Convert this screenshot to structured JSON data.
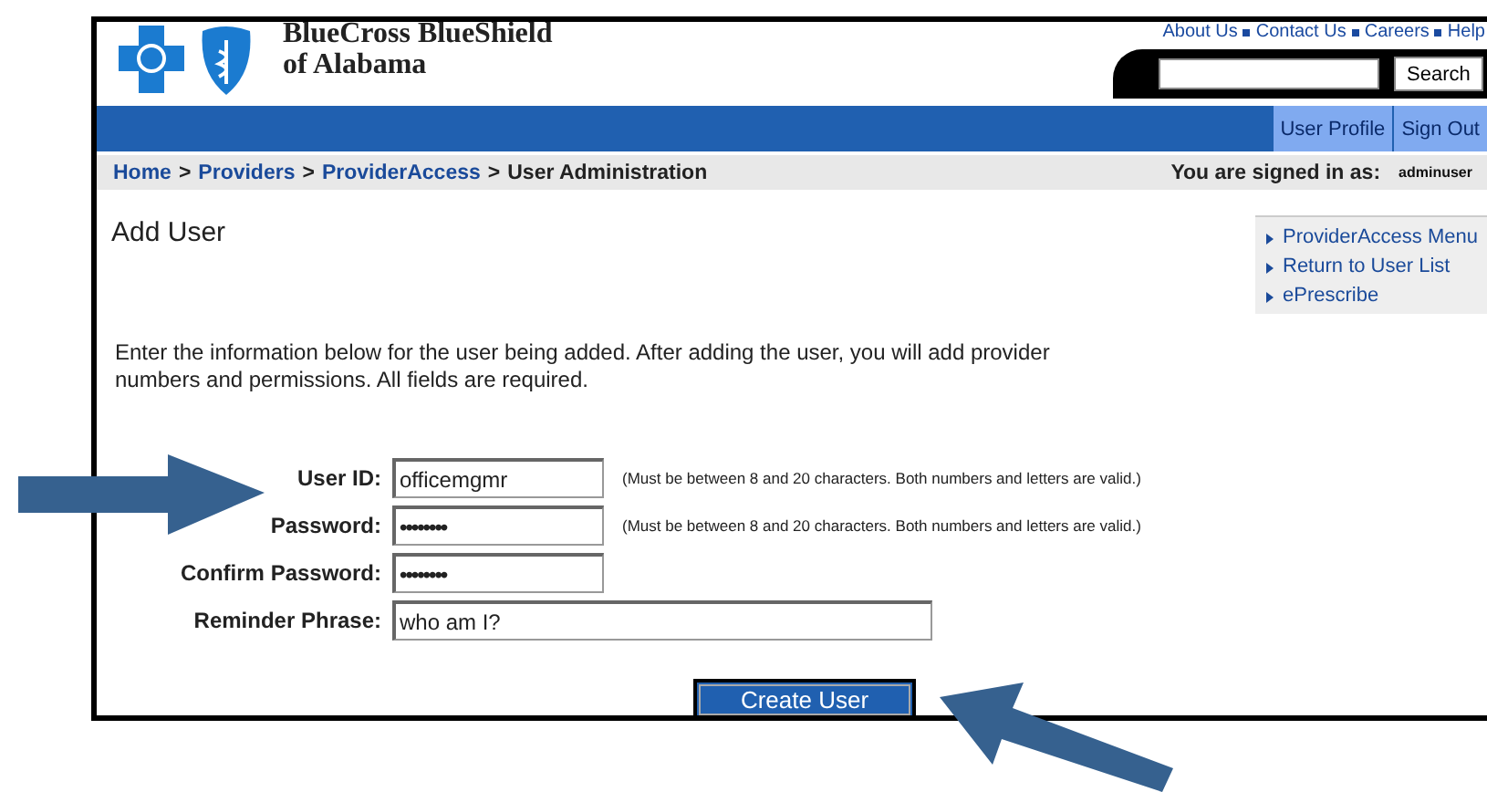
{
  "header": {
    "logo_lines": [
      "BlueCross BlueShield",
      "of Alabama"
    ],
    "top_links": [
      "About Us",
      "Contact Us",
      "Careers",
      "Help"
    ],
    "search": {
      "button": "Search"
    }
  },
  "nav": {
    "tabs": [
      "User Profile",
      "Sign Out"
    ]
  },
  "breadcrumb": {
    "items": [
      {
        "kind": "link",
        "text": "Home"
      },
      {
        "kind": "separator",
        "text": ">"
      },
      {
        "kind": "link",
        "text": "Providers"
      },
      {
        "kind": "separator",
        "text": ">"
      },
      {
        "kind": "link",
        "text": "ProviderAccess"
      },
      {
        "kind": "separator",
        "text": ">"
      },
      {
        "kind": "current",
        "text": "User Administration"
      }
    ],
    "signed_in_label": "You are signed in as:",
    "username": "adminuser"
  },
  "page_title": "Add User",
  "side_menu": [
    "ProviderAccess Menu",
    "Return to User List",
    "ePrescribe"
  ],
  "intro": "Enter the information below for the user being added. After adding the user, you will add provider numbers and permissions. All fields are required.",
  "fields": [
    {
      "label": "User ID:",
      "kind": "text",
      "value": "officemgmr",
      "hint": "(Must be between 8 and 20 characters. Both numbers and letters are valid.)"
    },
    {
      "label": "Password:",
      "kind": "password",
      "value": "••••••••",
      "hint": "(Must be between 8 and 20 characters. Both numbers and letters are valid.)"
    },
    {
      "label": "Confirm Password:",
      "kind": "password",
      "value": "••••••••"
    },
    {
      "label": "Reminder Phrase:",
      "kind": "phrase",
      "value": "who am I?"
    }
  ],
  "submit": "Create User"
}
